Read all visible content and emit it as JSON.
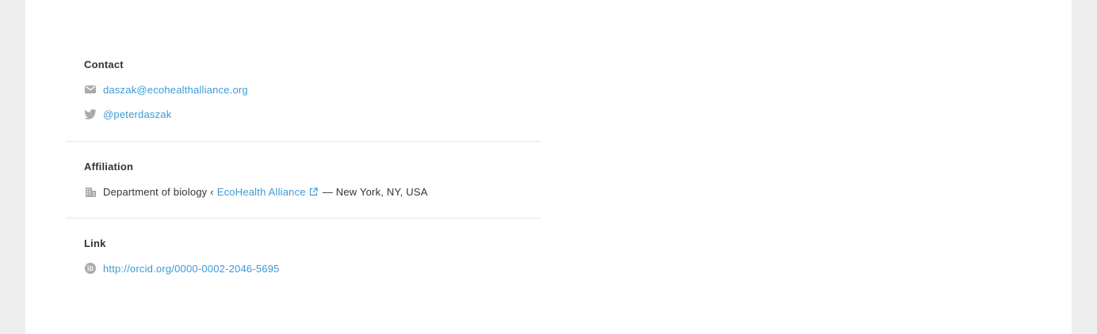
{
  "contact": {
    "heading": "Contact",
    "email": "daszak@ecohealthalliance.org",
    "twitter": "@peterdaszak"
  },
  "affiliation": {
    "heading": "Affiliation",
    "department": "Department of biology ‹",
    "organization": "EcoHealth Alliance",
    "location": "— New York, NY, USA"
  },
  "link": {
    "heading": "Link",
    "orcid_url": "http://orcid.org/0000-0002-2046-5695"
  },
  "colors": {
    "link": "#3b9ad9",
    "text": "#333333",
    "icon": "#aaaaaa",
    "background": "#eeeeee",
    "card": "#ffffff"
  },
  "icons": [
    "envelope-icon",
    "twitter-icon",
    "building-icon",
    "external-link-icon",
    "orcid-icon"
  ]
}
